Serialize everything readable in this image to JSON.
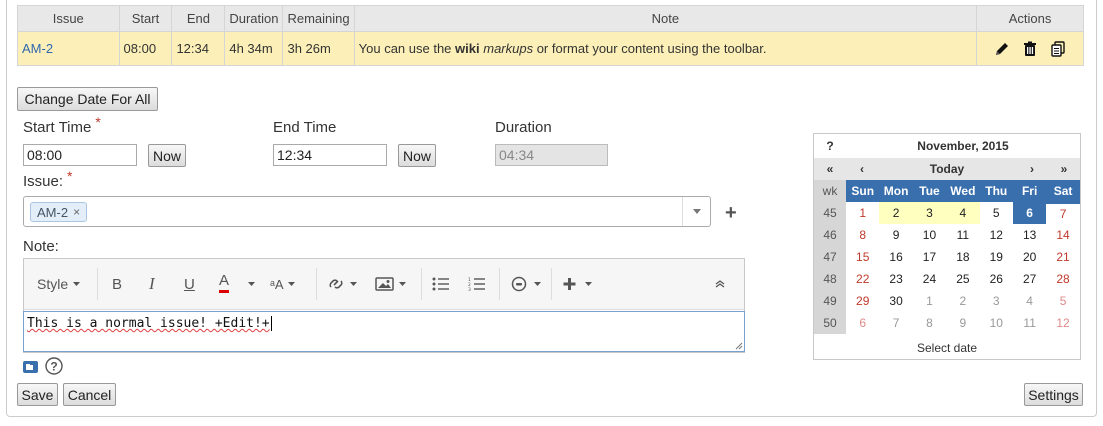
{
  "table": {
    "headers": [
      "Issue",
      "Start",
      "End",
      "Duration",
      "Remaining",
      "Note",
      "Actions"
    ],
    "row": {
      "issue": "AM-2",
      "start": "08:00",
      "end": "12:34",
      "duration": "4h 34m",
      "remaining": "3h 26m",
      "note_pre": "You can use the ",
      "note_bold": "wiki",
      "note_italic": "markups",
      "note_post": " or format your content using the toolbar."
    }
  },
  "form": {
    "change_date_all": "Change Date For All",
    "start_time_label": "Start Time",
    "start_time_value": "08:00",
    "start_now": "Now",
    "end_time_label": "End Time",
    "end_time_value": "12:34",
    "end_now": "Now",
    "duration_label": "Duration",
    "duration_value": "04:34",
    "required_mark": "*",
    "issue_label": "Issue:",
    "issue_chip": "AM-2",
    "issue_chip_remove": "×",
    "add": "+",
    "note_label": "Note:",
    "note_text": "This is a normal issue! +Edit!+",
    "save": "Save",
    "cancel": "Cancel",
    "settings": "Settings"
  },
  "toolbar": {
    "style": "Style",
    "bold": "B",
    "italic": "I",
    "underline": "U",
    "font_color": "A",
    "font_size": "ᵃA"
  },
  "calendar": {
    "help": "?",
    "title": "November, 2015",
    "nav_prev_year": "«",
    "nav_prev": "‹",
    "today": "Today",
    "nav_next": "›",
    "nav_next_year": "»",
    "wk_label": "wk",
    "weekdays": [
      "Sun",
      "Mon",
      "Tue",
      "Wed",
      "Thu",
      "Fri",
      "Sat"
    ],
    "weeks": [
      {
        "wk": "45",
        "days": [
          "1",
          "2",
          "3",
          "4",
          "5",
          "6",
          "7"
        ]
      },
      {
        "wk": "46",
        "days": [
          "8",
          "9",
          "10",
          "11",
          "12",
          "13",
          "14"
        ]
      },
      {
        "wk": "47",
        "days": [
          "15",
          "16",
          "17",
          "18",
          "19",
          "20",
          "21"
        ]
      },
      {
        "wk": "48",
        "days": [
          "22",
          "23",
          "24",
          "25",
          "26",
          "27",
          "28"
        ]
      },
      {
        "wk": "49",
        "days": [
          "29",
          "30",
          "1",
          "2",
          "3",
          "4",
          "5"
        ]
      },
      {
        "wk": "50",
        "days": [
          "6",
          "7",
          "8",
          "9",
          "10",
          "11",
          "12"
        ]
      }
    ],
    "footer": "Select date",
    "colors": {
      "header": "#3a6fae",
      "weekend": "#c0392b",
      "highlight": "#ffffc0",
      "selected": "#3a6fae"
    }
  }
}
